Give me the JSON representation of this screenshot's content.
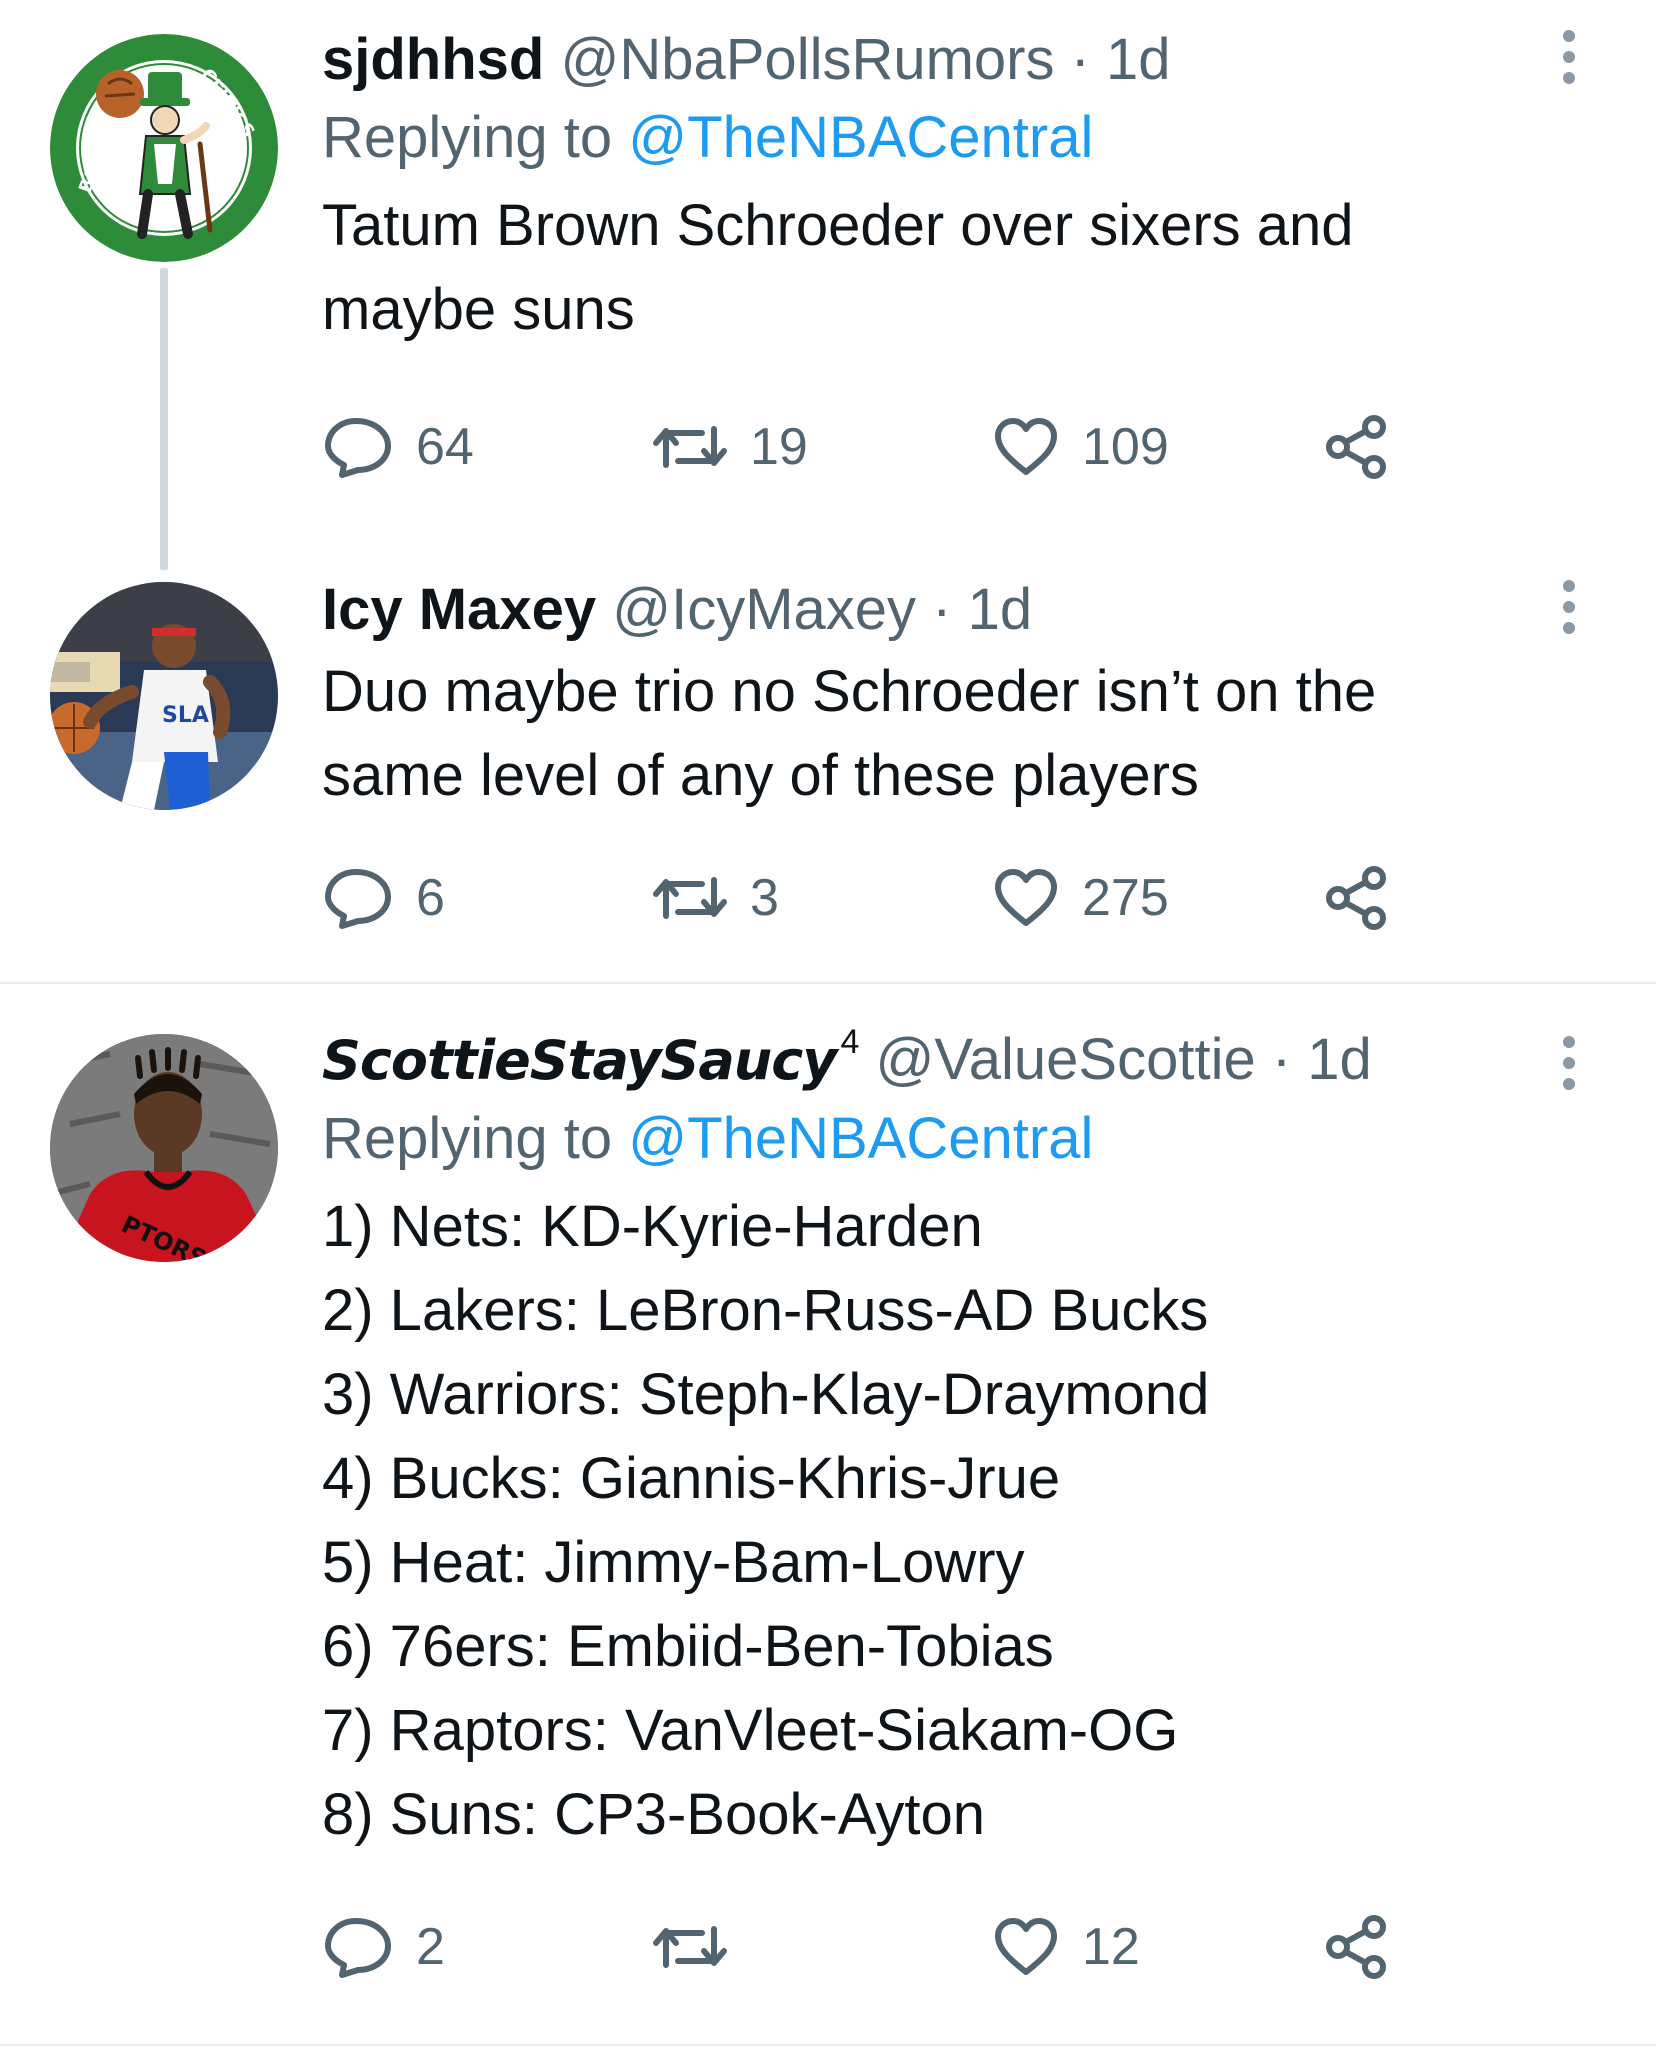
{
  "tweets": [
    {
      "display_name": "sjdhhsd",
      "handle": "@NbaPollsRumors",
      "time": "· 1d",
      "replying_prefix": "Replying to",
      "replying_to": "@TheNBACentral",
      "text": "Tatum Brown Schroeder over sixers and\nmaybe suns",
      "replies": "64",
      "retweets": "19",
      "likes": "109",
      "avatar_icon": "boston-celtics-logo",
      "avatar_ring_text_left": "BOSTON",
      "avatar_ring_text_right": "CELTICS"
    },
    {
      "display_name": "Icy Maxey",
      "handle": "@IcyMaxey",
      "time": "· 1d",
      "text": "Duo maybe trio no Schroeder isn’t on the\nsame level of any of these players",
      "replies": "6",
      "retweets": "3",
      "likes": "275",
      "avatar_icon": "basketball-player-photo"
    },
    {
      "display_name": "ScottieStaySaucy",
      "badge": "4",
      "handle": "@ValueScottie",
      "time": "· 1d",
      "replying_prefix": "Replying to",
      "replying_to": "@TheNBACentral",
      "text": "1) Nets: KD-Kyrie-Harden\n2) Lakers: LeBron-Russ-AD Bucks\n3) Warriors: Steph-Klay-Draymond\n4) Bucks: Giannis-Khris-Jrue\n5) Heat: Jimmy-Bam-Lowry\n6) 76ers: Embiid-Ben-Tobias\n7) Raptors: VanVleet-Siakam-OG\n8) Suns: CP3-Book-Ayton",
      "replies": "2",
      "retweets": "",
      "likes": "12",
      "avatar_icon": "raptors-player-photo"
    }
  ],
  "colors": {
    "text": "#0f1419",
    "secondary": "#536471",
    "link": "#1d9bf0",
    "thread_line": "#cfd9de",
    "divider": "#e6ecf0",
    "celtics_green": "#2e8b3a"
  },
  "icons": {
    "reply": "reply-bubble-icon",
    "retweet": "retweet-icon",
    "like": "heart-icon",
    "share": "share-icon",
    "more": "more-options-icon"
  }
}
